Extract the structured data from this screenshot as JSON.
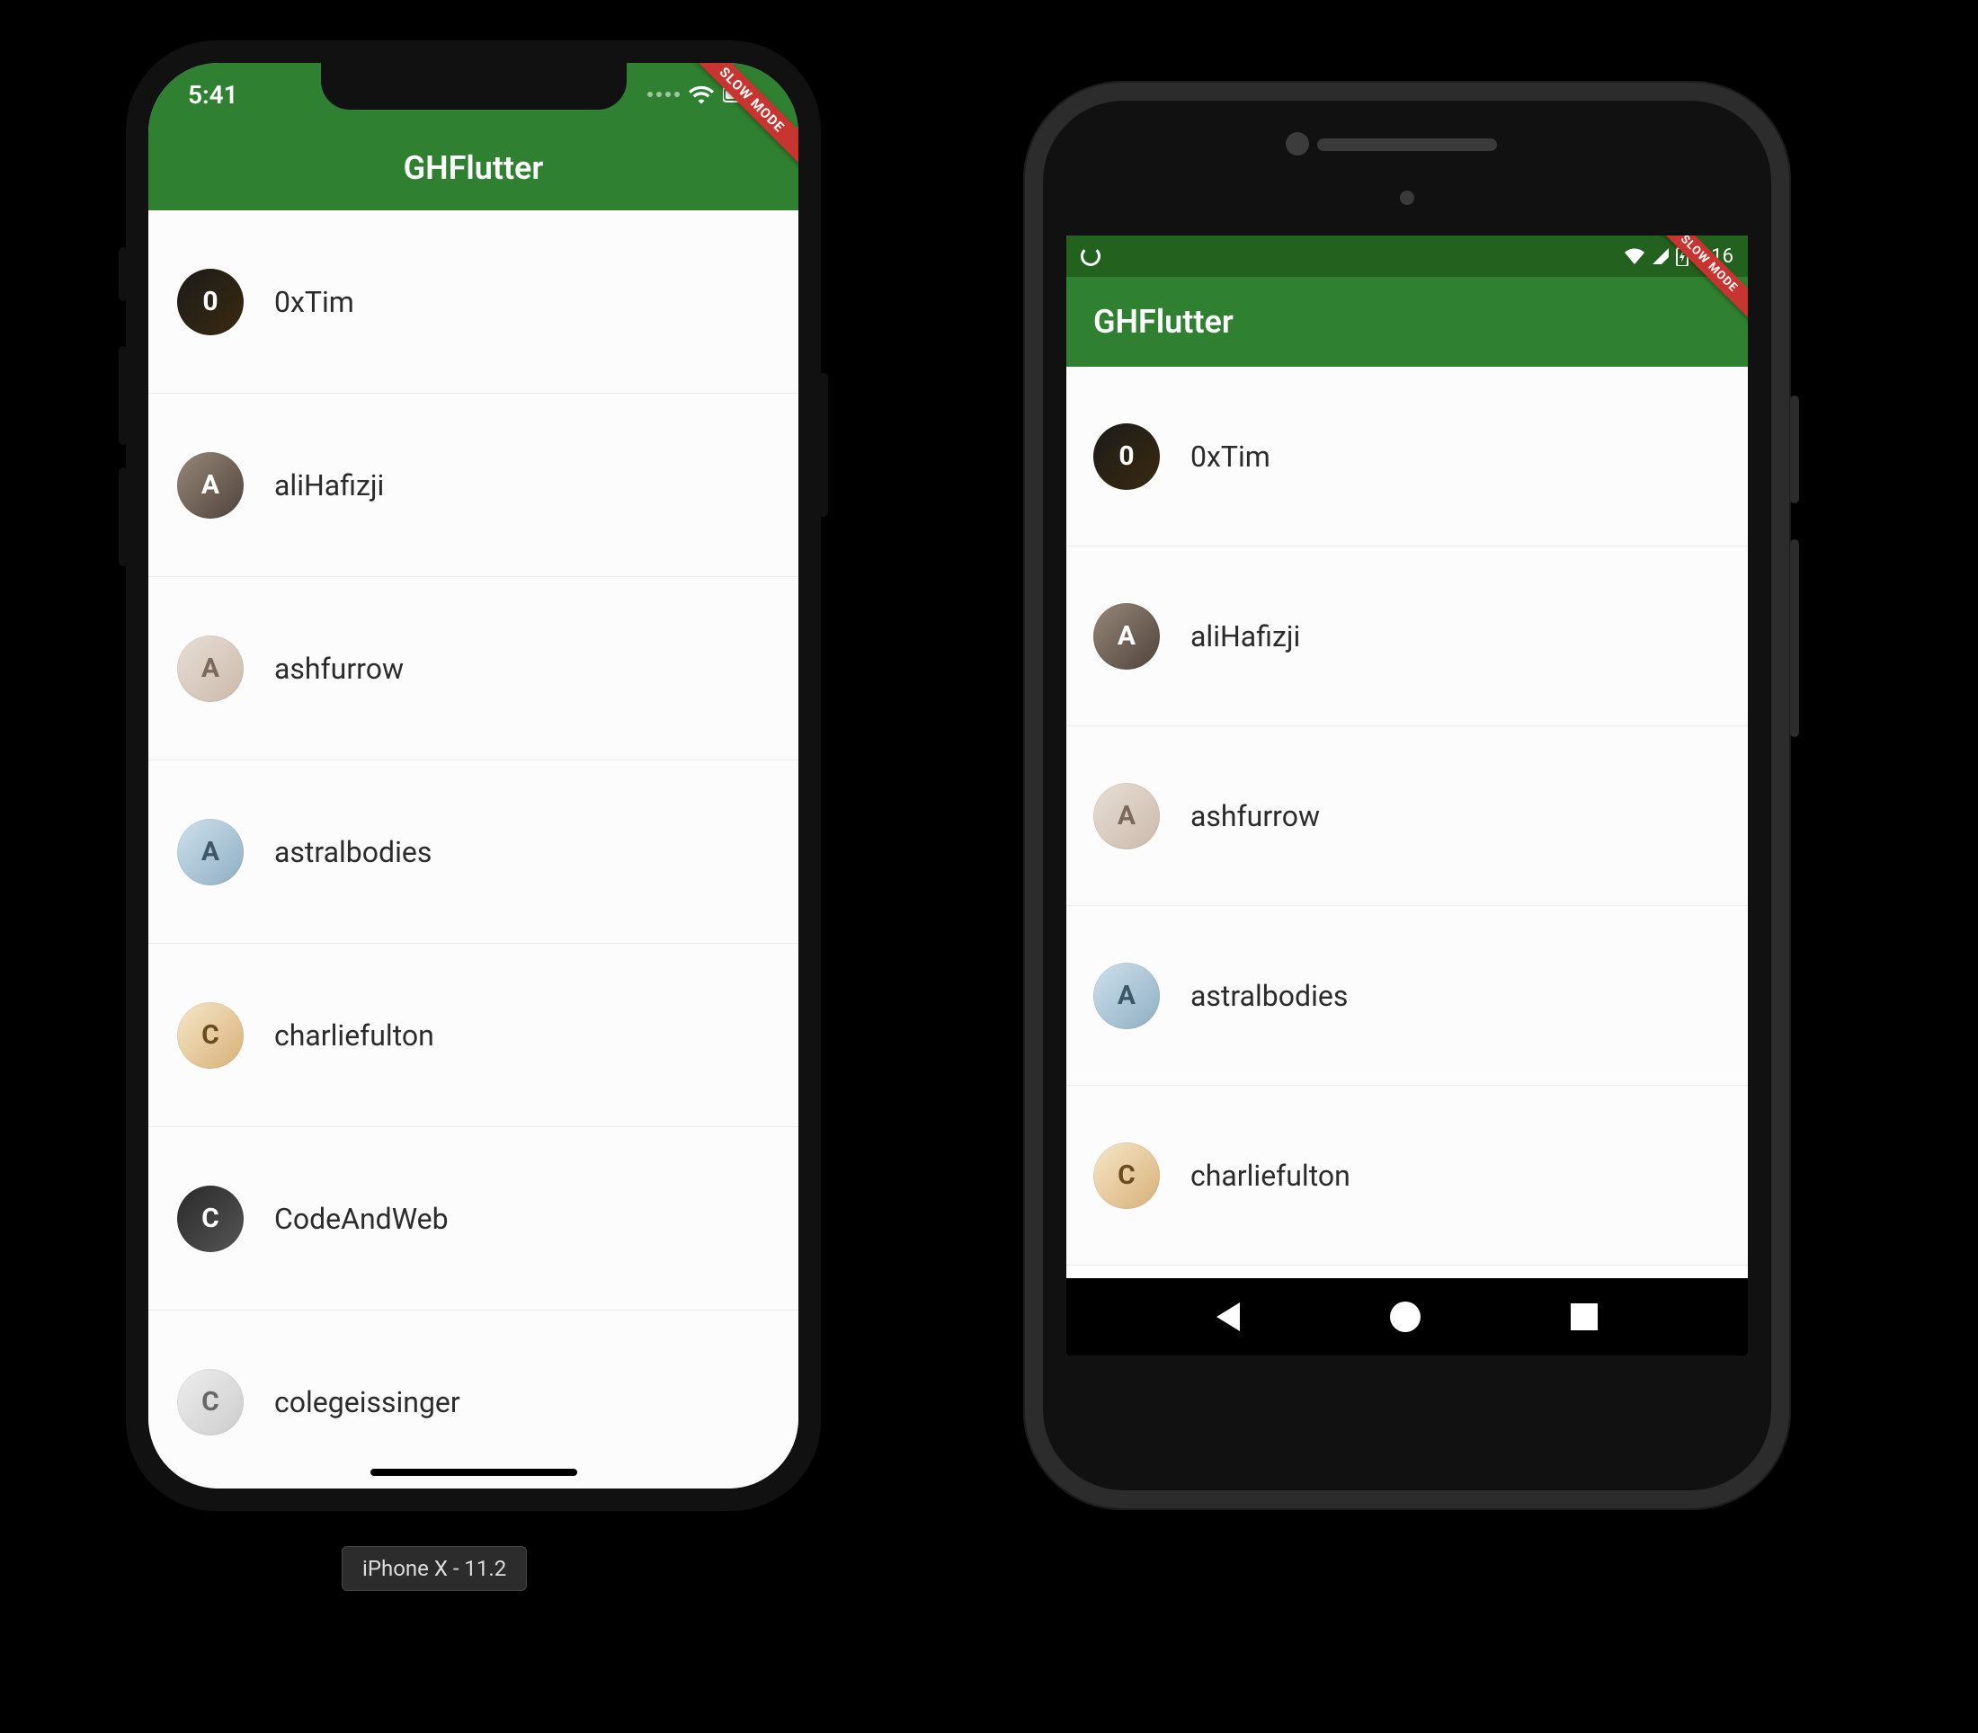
{
  "app_title": "GHFlutter",
  "debug_banner": "SLOW MODE",
  "ios": {
    "status_time": "5:41",
    "device_caption": "iPhone X - 11.2"
  },
  "android": {
    "status_time": "6:16"
  },
  "users": [
    {
      "login": "0xTim",
      "avatar_color": "c0",
      "initial": "0"
    },
    {
      "login": "aliHafizji",
      "avatar_color": "c1",
      "initial": "A"
    },
    {
      "login": "ashfurrow",
      "avatar_color": "c2",
      "initial": "A"
    },
    {
      "login": "astralbodies",
      "avatar_color": "c3",
      "initial": "A"
    },
    {
      "login": "charliefulton",
      "avatar_color": "c4",
      "initial": "C"
    },
    {
      "login": "CodeAndWeb",
      "avatar_color": "c5",
      "initial": "C"
    },
    {
      "login": "colegeissinger",
      "avatar_color": "c6",
      "initial": "C"
    }
  ],
  "visible_counts": {
    "ios_rows": 7,
    "android_rows": 5
  }
}
